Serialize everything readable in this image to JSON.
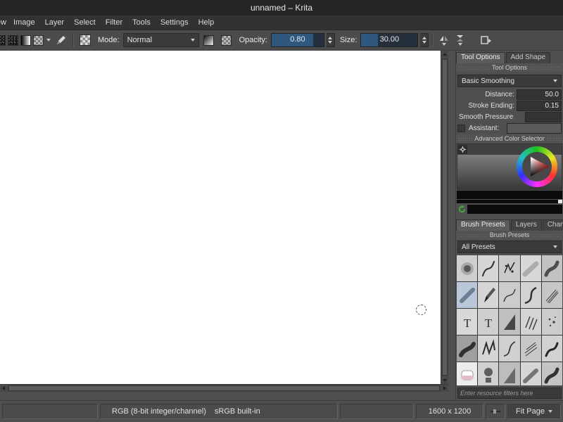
{
  "window": {
    "title": "unnamed – Krita"
  },
  "menubar": {
    "items": [
      {
        "label": "View",
        "clipped": true
      },
      {
        "label": "Image"
      },
      {
        "label": "Layer"
      },
      {
        "label": "Select"
      },
      {
        "label": "Filter"
      },
      {
        "label": "Tools"
      },
      {
        "label": "Settings"
      },
      {
        "label": "Help"
      }
    ]
  },
  "toolbar": {
    "mode_label": "Mode:",
    "mode_value": "Normal",
    "opacity_label": "Opacity:",
    "opacity_value": "0.80",
    "opacity_fill": "80%",
    "size_label": "Size:",
    "size_value": "30.00",
    "size_fill": "30%"
  },
  "tool_options": {
    "tabs": [
      {
        "label": "Tool Options",
        "active": true
      },
      {
        "label": "Add Shape",
        "active": false
      }
    ],
    "title": "Tool Options",
    "smoothing_mode": "Basic Smoothing",
    "fields": [
      {
        "label": "Distance:",
        "value": "50.0",
        "type": "spin"
      },
      {
        "label": "Stroke Ending:",
        "value": "0.15",
        "type": "spin"
      },
      {
        "label": "Smooth Pressure",
        "value": "",
        "type": "check-right"
      },
      {
        "label": "Assistant:",
        "value": "",
        "type": "check-slider"
      }
    ]
  },
  "color_selector": {
    "title": "Advanced Color Selector"
  },
  "brush_docker": {
    "tabs": [
      {
        "label": "Brush Presets",
        "active": true
      },
      {
        "label": "Layers",
        "active": false
      },
      {
        "label": "Channels",
        "active": false
      }
    ],
    "title": "Brush Presets",
    "filter_value": "All Presets",
    "search_placeholder": "Enter resource filters here",
    "presets": [
      {
        "icon": "airbrush-soft-icon",
        "bg": "#cfcfcf"
      },
      {
        "icon": "ink-pen-icon",
        "bg": "#d6d6d6"
      },
      {
        "icon": "ink-splatter-icon",
        "bg": "#cacaca"
      },
      {
        "icon": "soft-brush-icon",
        "bg": "#d8d8d8"
      },
      {
        "icon": "texture-stroke-icon",
        "bg": "#c2c2c2"
      },
      {
        "icon": "chalk-brush-icon",
        "bg": "#b9c7d9"
      },
      {
        "icon": "pencil-icon",
        "bg": "#d6d6d6"
      },
      {
        "icon": "fineliner-icon",
        "bg": "#cccccc"
      },
      {
        "icon": "curve-brush-icon",
        "bg": "#d2d2d2"
      },
      {
        "icon": "bristle-brush-icon",
        "bg": "#c6c6c6"
      },
      {
        "icon": "text-brush-icon",
        "bg": "#d8d8d8"
      },
      {
        "icon": "text-brush-icon",
        "bg": "#cfcfcf"
      },
      {
        "icon": "fill-wedge-icon",
        "bg": "#c0c0c0"
      },
      {
        "icon": "hatching-brush-icon",
        "bg": "#d4d4d4"
      },
      {
        "icon": "spray-brush-icon",
        "bg": "#cccccc"
      },
      {
        "icon": "smudge-brush-icon",
        "bg": "#9f9f9f"
      },
      {
        "icon": "zigzag-brush-icon",
        "bg": "#d6d6d6"
      },
      {
        "icon": "sketch-brush-icon",
        "bg": "#d0d0d0"
      },
      {
        "icon": "scratch-brush-icon",
        "bg": "#c8c8c8"
      },
      {
        "icon": "ink-stroke-icon",
        "bg": "#d2d2d2"
      },
      {
        "icon": "eraser-icon",
        "bg": "#ececec"
      },
      {
        "icon": "stamp-brush-icon",
        "bg": "#d0d0d0"
      },
      {
        "icon": "shade-wedge-icon",
        "bg": "#bdbdbd"
      },
      {
        "icon": "marker-icon",
        "bg": "#d6d6d6"
      },
      {
        "icon": "thick-stroke-icon",
        "bg": "#c4c4c4"
      }
    ]
  },
  "statusbar": {
    "color_mode": "RGB (8-bit integer/channel)",
    "profile": "sRGB built-in",
    "canvas_size": "1600 x 1200",
    "zoom_mode": "Fit Page"
  },
  "colors": {
    "accent_blue": "#30587e",
    "canvas_white": "#ffffff",
    "ui_gray": "#4f4f4f"
  }
}
